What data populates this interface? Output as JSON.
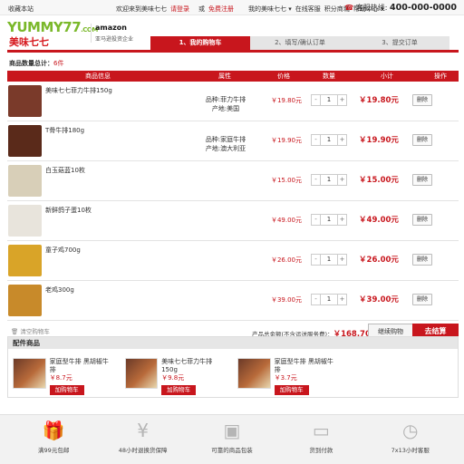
{
  "topbar": {
    "site_label": "收藏本站",
    "welcome": "欢迎来到美味七七",
    "login": "请登录",
    "or": "或",
    "register": "免费注册",
    "my_account": "我的美味七七 ▾",
    "online_service": "在线客服",
    "points_mall": "积分商城",
    "help_center": "帮助中心 ▾",
    "hotline_label": "客服热线:",
    "hotline_number": "400-000-0000"
  },
  "logo": {
    "en": "YUMMY77",
    "dotcom": ".COM",
    "cn": "美味七七"
  },
  "partner": {
    "brand": "amazon",
    "caption": "亚马逊投资企业"
  },
  "steps": [
    "1、我的购物车",
    "2、填写/确认订单",
    "3、提交订单"
  ],
  "cart": {
    "count_label": "商品数量总计：",
    "count_value": "6件",
    "headers": {
      "info": "商品信息",
      "attr": "属性",
      "price": "价格",
      "qty": "数量",
      "subtotal": "小计",
      "op": "操作"
    },
    "items": [
      {
        "name": "美味七七菲力牛排150g",
        "attr1": "品种:菲力牛排",
        "attr2": "产地:美国",
        "price": "￥19.80元",
        "qty": "1",
        "subtotal": "￥19.80元",
        "delete": "删除",
        "color": "#7a3a2a"
      },
      {
        "name": "T骨牛排180g",
        "attr1": "品种:家庭牛排",
        "attr2": "产地:澳大利亚",
        "price": "￥19.90元",
        "qty": "1",
        "subtotal": "￥19.90元",
        "delete": "删除",
        "color": "#5a2a1a"
      },
      {
        "name": "白玉菇蓝10枚",
        "attr1": "",
        "attr2": "",
        "price": "￥15.00元",
        "qty": "1",
        "subtotal": "￥15.00元",
        "delete": "删除",
        "color": "#d8cfb8"
      },
      {
        "name": "新鲜鸽子蛋10枚",
        "attr1": "",
        "attr2": "",
        "price": "￥49.00元",
        "qty": "1",
        "subtotal": "￥49.00元",
        "delete": "删除",
        "color": "#e8e4dc"
      },
      {
        "name": "童子鸡700g",
        "attr1": "",
        "attr2": "",
        "price": "￥26.00元",
        "qty": "1",
        "subtotal": "￥26.00元",
        "delete": "删除",
        "color": "#d9a428"
      },
      {
        "name": "老鸡300g",
        "attr1": "",
        "attr2": "",
        "price": "￥39.00元",
        "qty": "1",
        "subtotal": "￥39.00元",
        "delete": "删除",
        "color": "#c88a2a"
      }
    ],
    "clear": "清空购物车",
    "total_label": "产品总金额(不含运送服务费)：",
    "total_value": "￥168.70元",
    "continue": "继续购物",
    "checkout": "去结算"
  },
  "accessories": {
    "title": "配件商品",
    "items": [
      {
        "name": "家庭型牛排 黑胡椒牛排",
        "price": "￥8.7元",
        "buy": "加购物车"
      },
      {
        "name": "美味七七菲力牛排150g",
        "price": "￥9.8元",
        "buy": "加购物车"
      },
      {
        "name": "家庭型牛排 黑胡椒牛排",
        "price": "￥3.7元",
        "buy": "加购物车"
      }
    ]
  },
  "services": [
    {
      "icon": "gift-icon",
      "label": "满99元包邮"
    },
    {
      "icon": "yen-icon",
      "label": "48小时退换货保障"
    },
    {
      "icon": "package-icon",
      "label": "可靠的商品包装"
    },
    {
      "icon": "card-icon",
      "label": "货到付款"
    },
    {
      "icon": "clock-icon",
      "label": "7x13小时客服"
    }
  ]
}
